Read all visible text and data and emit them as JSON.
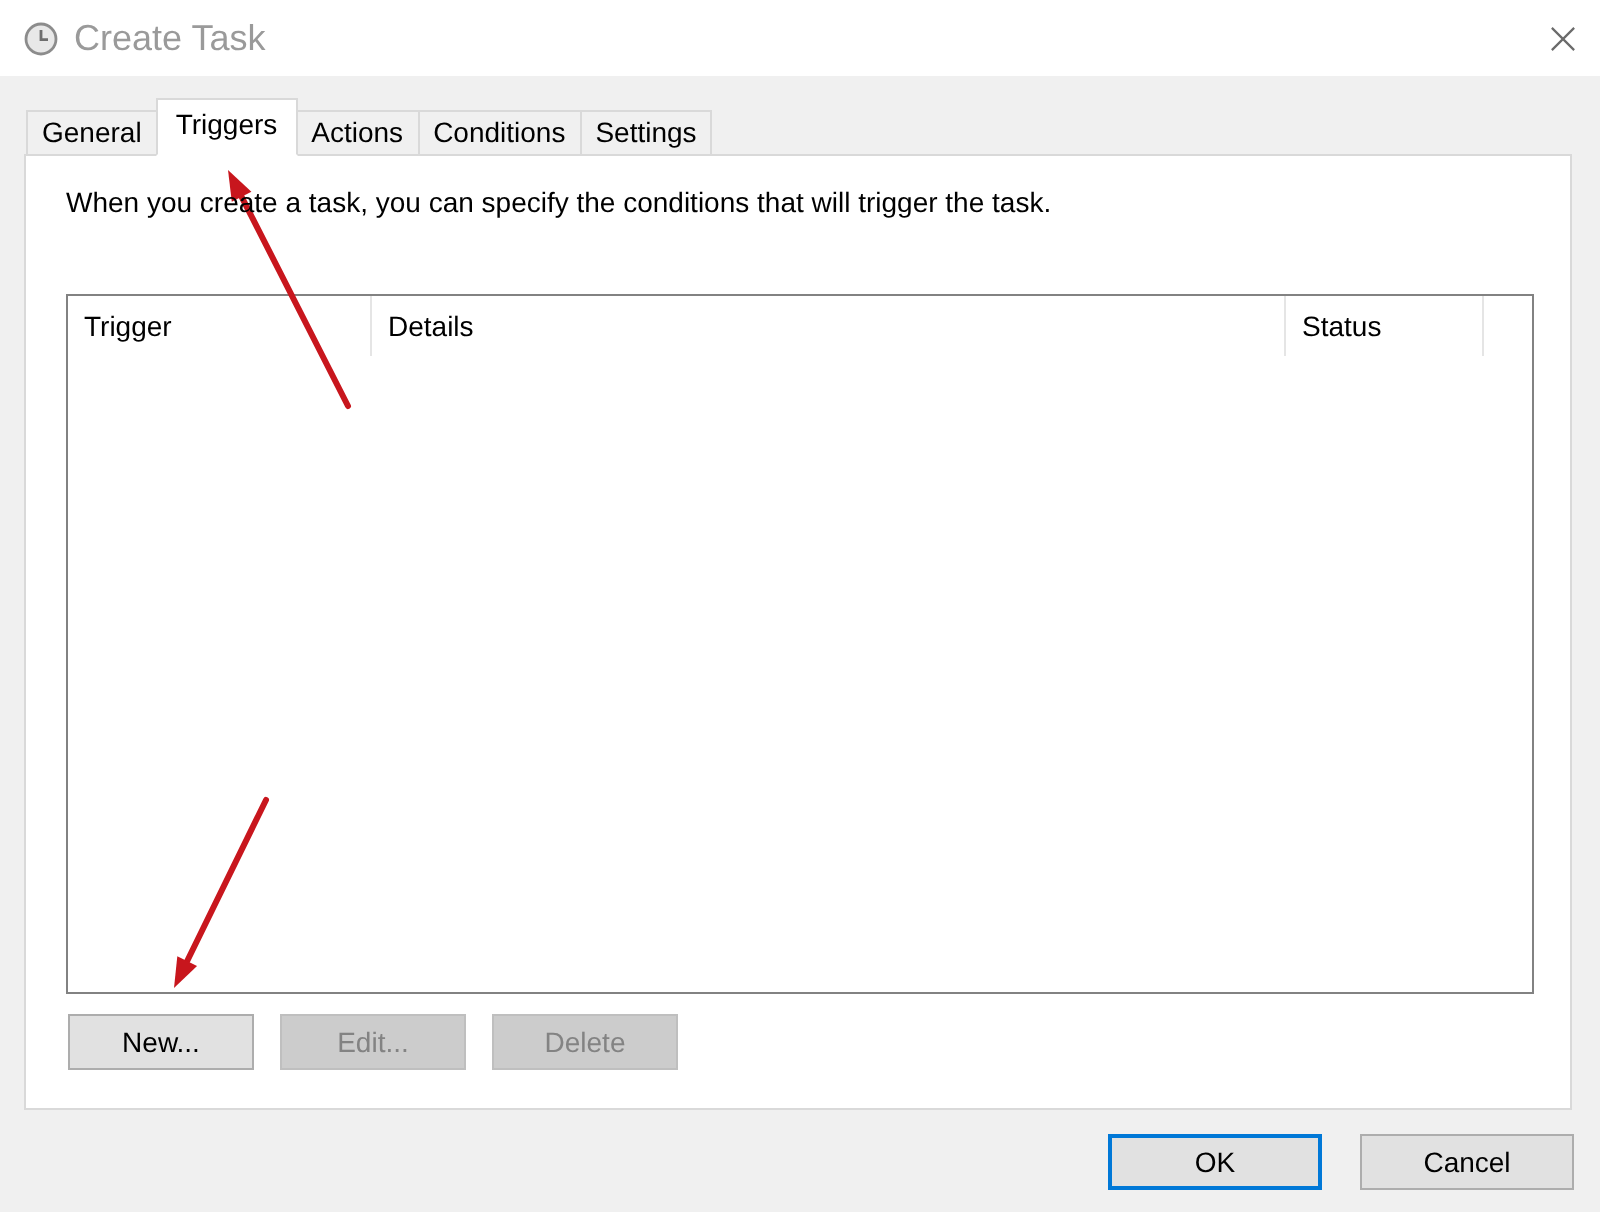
{
  "window": {
    "title": "Create Task"
  },
  "tabs": [
    {
      "label": "General",
      "selected": false,
      "arrow": false
    },
    {
      "label": "Triggers",
      "selected": true,
      "arrow": true
    },
    {
      "label": "Actions",
      "selected": false,
      "arrow": false
    },
    {
      "label": "Conditions",
      "selected": false,
      "arrow": false
    },
    {
      "label": "Settings",
      "selected": false,
      "arrow": false
    }
  ],
  "triggers_tab": {
    "description": "When you create a task, you can specify the conditions that will trigger the task.",
    "table": {
      "columns": [
        {
          "label": "Trigger"
        },
        {
          "label": "Details"
        },
        {
          "label": "Status"
        }
      ]
    },
    "buttons": [
      {
        "label": "New...",
        "disabled": false,
        "arrow": true
      },
      {
        "label": "Edit...",
        "disabled": true,
        "arrow": false
      },
      {
        "label": "Delete",
        "disabled": true,
        "arrow": false
      }
    ]
  },
  "dialog_buttons": [
    {
      "label": "OK",
      "default": true
    },
    {
      "label": "Cancel",
      "default": false
    }
  ]
}
